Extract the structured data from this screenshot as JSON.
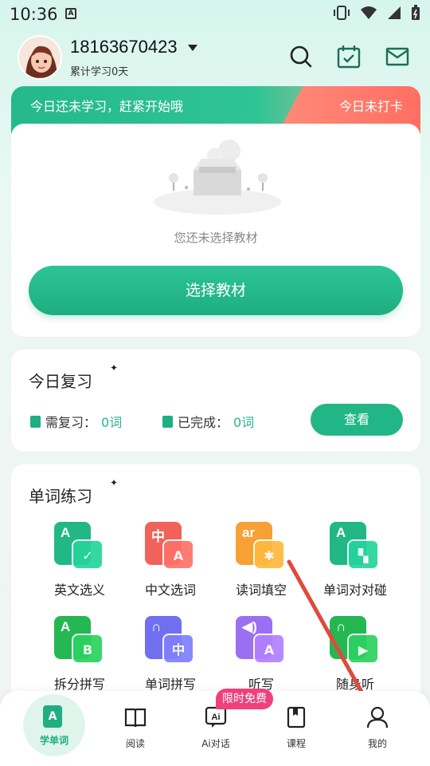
{
  "status_bar": {
    "time": "10:36",
    "notification_letter": "A"
  },
  "header": {
    "user_name": "18163670423",
    "study_days": "累计学习0天",
    "icons": [
      "search-icon",
      "calendar-check-icon",
      "mail-icon"
    ]
  },
  "banner": {
    "message": "今日还未学习，赶紧开始哦",
    "status": "今日未打卡"
  },
  "textbook": {
    "empty_tip": "您还未选择教材",
    "select_button": "选择教材"
  },
  "review": {
    "title": "今日复习",
    "need_label": "需复习：",
    "need_value": "0词",
    "done_label": "已完成：",
    "done_value": "0词",
    "view_button": "查看"
  },
  "practice": {
    "title": "单词练习",
    "items": [
      {
        "label": "英文选义",
        "back_text": "A",
        "front_text": "✓",
        "color": "#21b886"
      },
      {
        "label": "中文选词",
        "back_text": "中",
        "front_text": "A",
        "color": "#f0625a"
      },
      {
        "label": "读词填空",
        "back_text": "ar",
        "front_text": "✱",
        "color": "#f6a036"
      },
      {
        "label": "单词对对碰",
        "back_text": "A",
        "front_text": "▚",
        "color": "#21b886"
      },
      {
        "label": "拆分拼写",
        "back_text": "A",
        "front_text": "B",
        "color": "#25b752"
      },
      {
        "label": "单词拼写",
        "back_text": "∩",
        "front_text": "中",
        "color": "#6f6ff0"
      },
      {
        "label": "听写",
        "back_text": "◀)",
        "front_text": "A",
        "color": "#9a6ff2"
      },
      {
        "label": "随身听",
        "back_text": "∩",
        "front_text": "▶",
        "color": "#25b752"
      }
    ]
  },
  "bottom_nav": {
    "items": [
      {
        "label": "学单词",
        "active": true
      },
      {
        "label": "阅读"
      },
      {
        "label": "Ai对话"
      },
      {
        "label": "课程"
      },
      {
        "label": "我的"
      }
    ],
    "promo_badge": "限时免费"
  },
  "colors": {
    "accent": "#1eae80",
    "banner_red": "#ff6f63",
    "promo": "#f0407a",
    "arrow": "#e04a3c"
  }
}
